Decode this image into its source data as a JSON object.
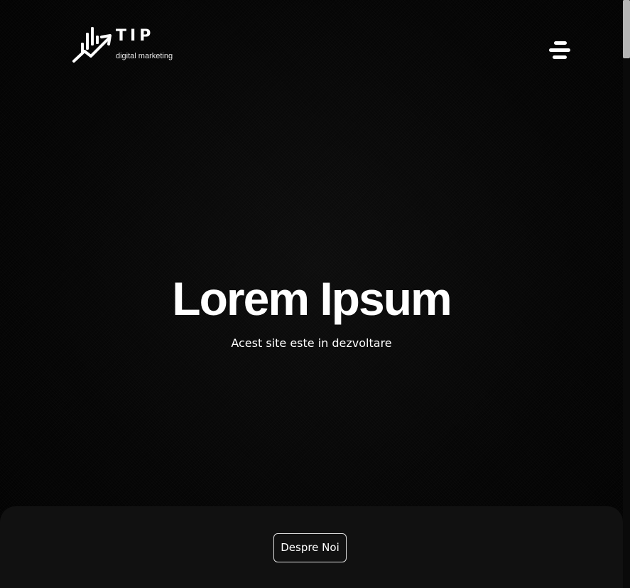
{
  "header": {
    "logo": {
      "wordmark": "TIP",
      "tagline": "digital marketing"
    },
    "menu_icon": "hamburger-menu-icon"
  },
  "hero": {
    "title": "Lorem Ipsum",
    "subtitle": "Acest site este in dezvoltare"
  },
  "panel": {
    "button_label": "Despre Noi"
  },
  "colors": {
    "background": "#000000",
    "panel": "#111111",
    "text": "#ffffff",
    "scroll_thumb": "#b5b5b5"
  }
}
